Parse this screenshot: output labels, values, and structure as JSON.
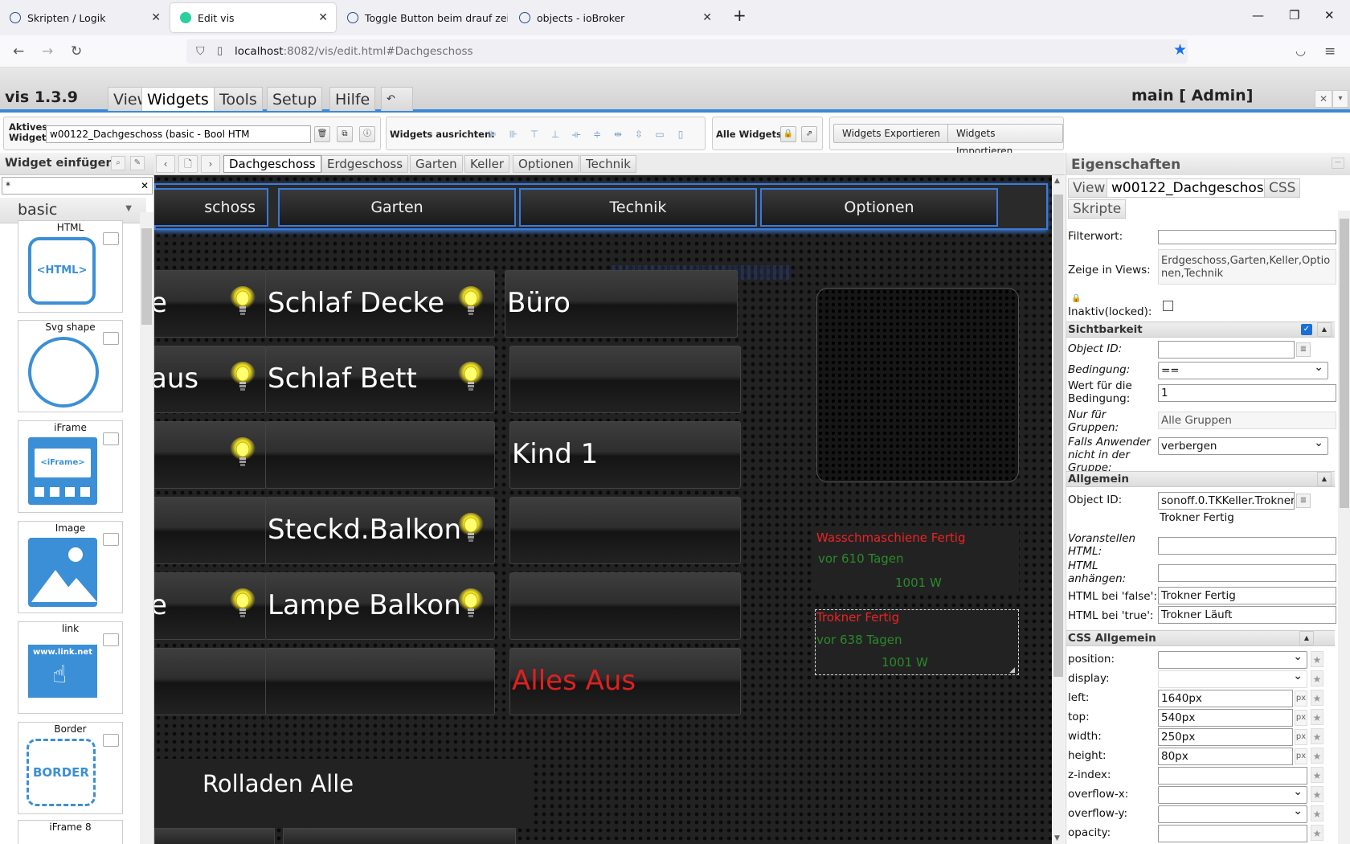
{
  "browser": {
    "tabs": [
      {
        "title": "Skripten / Logik"
      },
      {
        "title": "Edit vis"
      },
      {
        "title": "Toggle Button beim drauf zeigen"
      },
      {
        "title": "objects - ioBroker"
      }
    ],
    "url_host": "localhost",
    "url_path": ":8082/vis/edit.html#Dachgeschoss"
  },
  "vis": {
    "title": "vis 1.3.9",
    "menu": [
      "Views",
      "Widgets",
      "Tools",
      "Setup",
      "Hilfe"
    ],
    "main_admin": "main [ Admin]"
  },
  "toolbar": {
    "active_widget_label": "Aktives Widget:",
    "active_widget_value": "w00122_Dachgeschoss (basic - Bool HTM",
    "align_label": "Widgets ausrichten:",
    "all_widgets_label": "Alle Widgets:",
    "export_label": "Widgets Exportieren",
    "import_label": "Widgets Importieren"
  },
  "left": {
    "title": "Widget einfügen",
    "filter": "*",
    "set": "basic",
    "widgets": [
      {
        "name": "HTML",
        "text": "<HTML>"
      },
      {
        "name": "Svg shape",
        "text": ""
      },
      {
        "name": "iFrame",
        "text": "<iFrame>"
      },
      {
        "name": "Image",
        "text": ""
      },
      {
        "name": "link",
        "text": "www.link.net"
      },
      {
        "name": "Border",
        "text": "BORDER"
      },
      {
        "name": "iFrame 8",
        "text": ""
      }
    ]
  },
  "views": [
    "Dachgeschoss",
    "Erdgeschoss",
    "Garten",
    "Keller",
    "Optionen",
    "Technik"
  ],
  "canvas": {
    "nav": [
      "schoss",
      "Garten",
      "Technik",
      "Optionen"
    ],
    "tiles": [
      {
        "label": "e",
        "bulb": true
      },
      {
        "label": "Schlaf Decke",
        "bulb": true
      },
      {
        "label": "Büro",
        "bulb": false
      },
      {
        "label": "aus",
        "bulb": true
      },
      {
        "label": "Schlaf Bett",
        "bulb": true
      },
      {
        "label": "",
        "bulb": false
      },
      {
        "label": "",
        "bulb": true
      },
      {
        "label": "",
        "bulb": false
      },
      {
        "label": "Kind 1",
        "bulb": false
      },
      {
        "label": "",
        "bulb": false
      },
      {
        "label": "Steckd.Balkon",
        "bulb": true
      },
      {
        "label": "",
        "bulb": false
      },
      {
        "label": "e",
        "bulb": true
      },
      {
        "label": "Lampe Balkon",
        "bulb": true
      },
      {
        "label": "",
        "bulb": false
      },
      {
        "label": "",
        "bulb": false
      },
      {
        "label": "",
        "bulb": false
      },
      {
        "label": "Alles Aus",
        "bulb": false,
        "color": "#e02020"
      }
    ],
    "rolladen": "Rolladen Alle",
    "info1": {
      "title": "Wasschmaschiene Fertig",
      "since": "vor 610 Tagen",
      "power": "1001 W"
    },
    "info2": {
      "title": "Trokner Fertig",
      "since": "vor 638 Tagen",
      "power": "1001 W"
    }
  },
  "props": {
    "title": "Eigenschaften",
    "tabs": [
      "View",
      "w00122_Dachgeschoss",
      "CSS",
      "Skripte"
    ],
    "filterwort_label": "Filterwort:",
    "zeige_label": "Zeige in Views:",
    "zeige_value": "Erdgeschoss,Garten,Keller,Optionen,Technik",
    "inaktiv_label": "Inaktiv(locked):",
    "sichtbarkeit": "Sichtbarkeit",
    "object_id_label": "Object ID:",
    "bedingung_label": "Bedingung:",
    "bedingung_value": "==",
    "wert_label": "Wert für die Bedingung:",
    "wert_value": "1",
    "gruppen_label": "Nur für Gruppen:",
    "gruppen_value": "Alle Gruppen",
    "falls_label": "Falls Anwender nicht in der Gruppe:",
    "falls_value": "verbergen",
    "allgemein": "Allgemein",
    "oid_value": "sonoff.0.TKKeller.Trokner",
    "oid_name": "Trokner Fertig",
    "voranstellen_label": "Voranstellen HTML:",
    "anhaengen_label": "HTML anhängen:",
    "false_label": "HTML bei 'false':",
    "false_value": "Trokner Fertig",
    "true_label": "HTML bei 'true':",
    "true_value": "Trokner Läuft",
    "css_allgemein": "CSS Allgemein",
    "css": {
      "position": "position:",
      "display": "display:",
      "left": "left:",
      "left_value": "1640px",
      "top": "top:",
      "top_value": "540px",
      "width": "width:",
      "width_value": "250px",
      "height": "height:",
      "height_value": "80px",
      "zindex": "z-index:",
      "overflowx": "overflow-x:",
      "overflowy": "overflow-y:",
      "opacity": "opacity:"
    }
  }
}
